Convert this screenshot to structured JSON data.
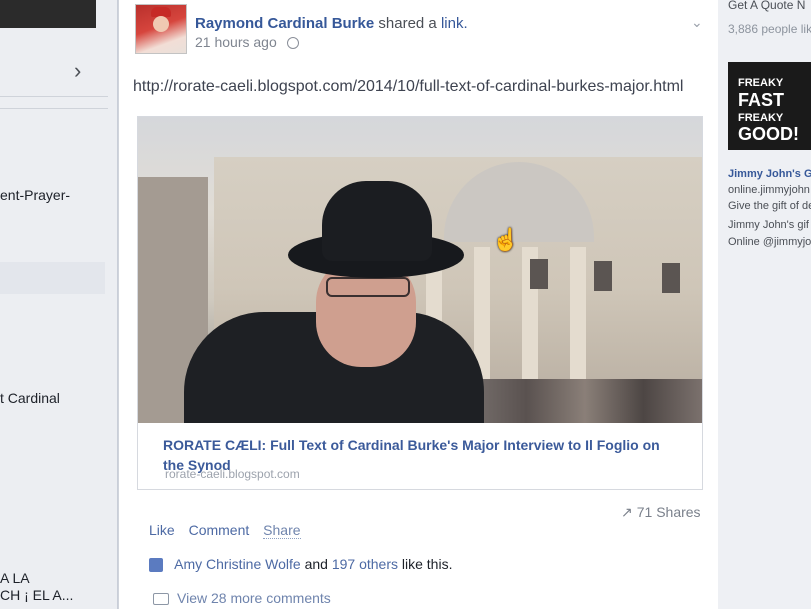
{
  "left_sidebar": {
    "fragments": [
      "ent-Prayer-",
      "t Cardinal",
      "A LA",
      "CH ¡ EL A..."
    ]
  },
  "post": {
    "author": "Raymond Cardinal Burke",
    "action": "shared a",
    "action_link": "link.",
    "time": "21 hours ago",
    "url": "http://rorate-caeli.blogspot.com/2014/10/full-text-of-cardinal-burkes-major.html",
    "card": {
      "title": "RORATE CÆLI: Full Text of Cardinal Burke's Major Interview to Il Foglio on the Synod",
      "domain": "rorate-caeli.blogspot.com"
    },
    "shares": "71 Shares",
    "actions": {
      "like": "Like",
      "comment": "Comment",
      "share": "Share"
    },
    "likes": {
      "name": "Amy Christine Wolfe",
      "conjunction": "and",
      "others": "197 others",
      "suffix": "like this."
    },
    "comments": "View 28 more comments"
  },
  "right_sidebar": {
    "top": "Get A Quote N",
    "people": "3,886 people lik",
    "ad": {
      "line1": "FREAKY",
      "line2": "FAST",
      "line3": "FREAKY",
      "line4": "GOOD!",
      "sponsor": "Jimmy John's G",
      "domain": "online.jimmyjohn",
      "body_1": "Give the gift of de",
      "body_2": "Jimmy John's gif",
      "body_3": "Online @jimmyjo"
    }
  }
}
